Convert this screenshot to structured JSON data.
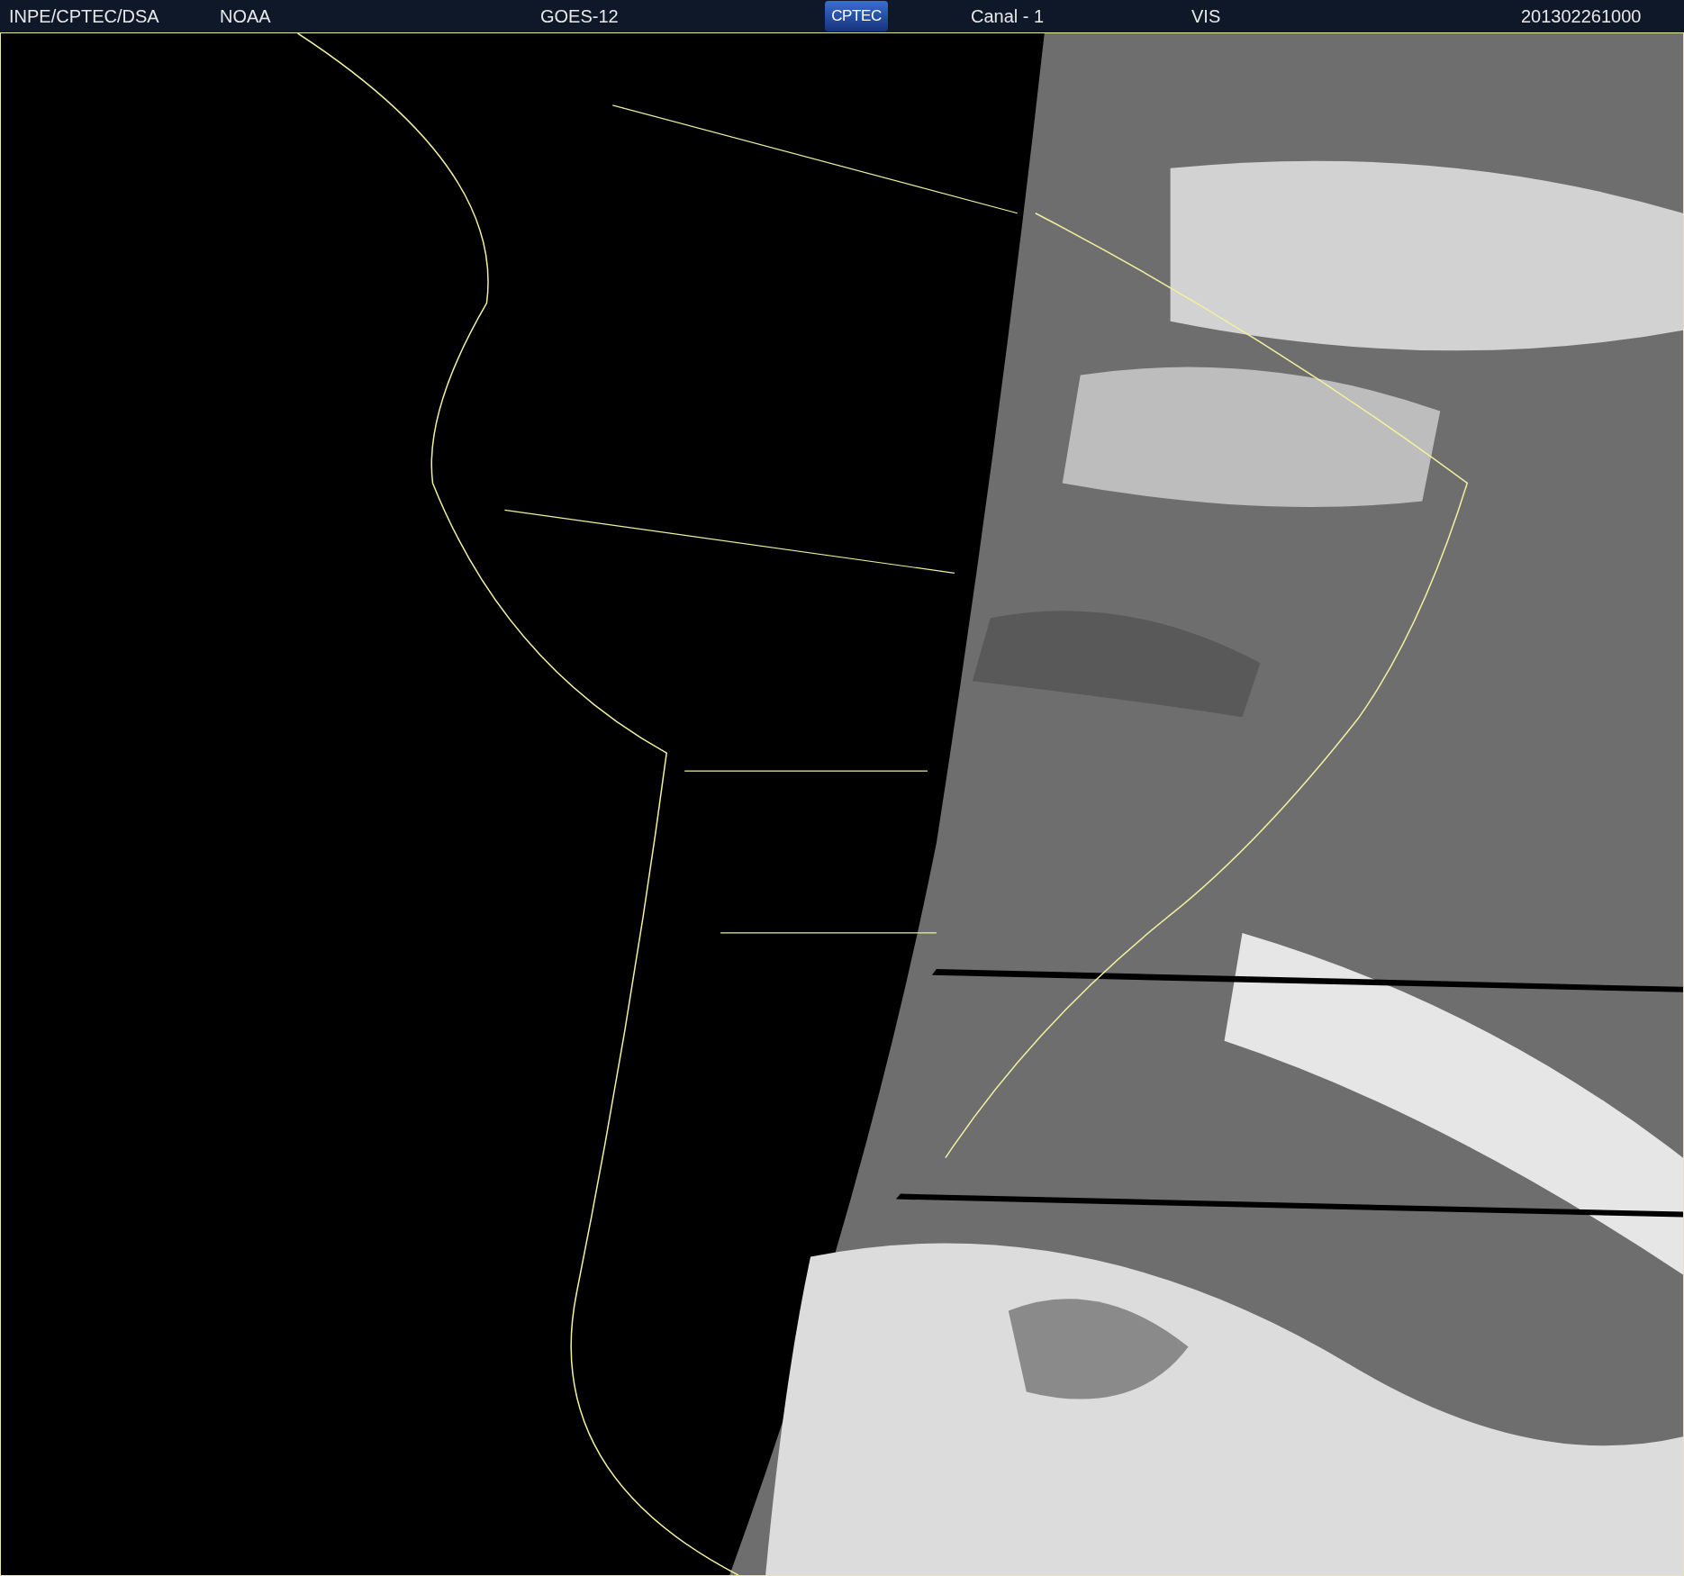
{
  "header": {
    "source": "INPE/CPTEC/DSA",
    "agency": "NOAA",
    "satellite": "GOES-12",
    "logo": "CPTEC",
    "channel": "Canal - 1",
    "band": "VIS",
    "timestamp": "201302261000"
  }
}
